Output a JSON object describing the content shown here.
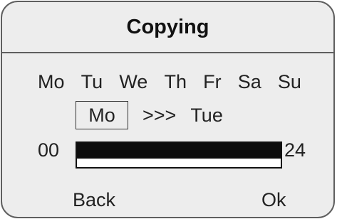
{
  "title": "Copying",
  "days": [
    "Mo",
    "Tu",
    "We",
    "Th",
    "Fr",
    "Sa",
    "Su"
  ],
  "copy": {
    "source_day": "Mo",
    "arrows": ">>>",
    "target_day": "Tue"
  },
  "timeline": {
    "start_label": "00",
    "end_label": "24",
    "fill_fraction": 1.0
  },
  "softkeys": {
    "back": "Back",
    "ok": "Ok"
  }
}
